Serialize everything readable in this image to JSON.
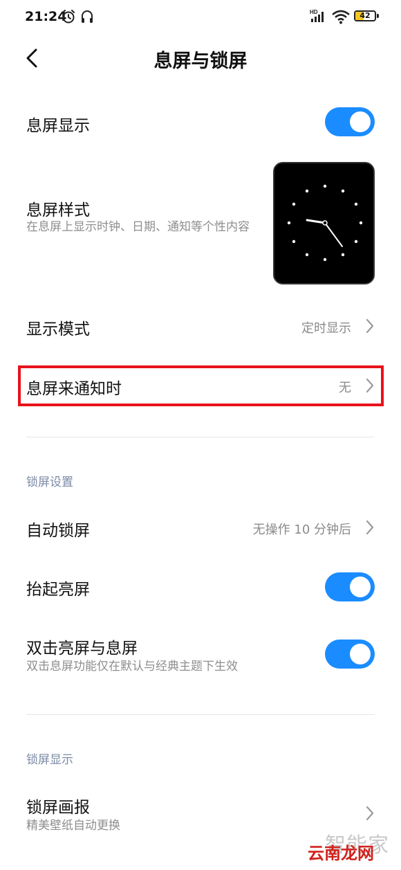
{
  "status_bar": {
    "time": "21:24",
    "signal_label": "HD",
    "battery_level": 42,
    "battery_text": "42",
    "icons": [
      "alarm-clock-icon",
      "headset-icon",
      "cellular-signal-icon",
      "wifi-icon",
      "battery-icon"
    ]
  },
  "header": {
    "title": "息屏与锁屏",
    "back_icon": "chevron-left-icon"
  },
  "aod": {
    "display": {
      "title": "息屏显示",
      "enabled": true
    },
    "style": {
      "title": "息屏样式",
      "subtitle": "在息屏上显示时钟、日期、通知等个性内容",
      "preview_icon": "analog-clock-icon"
    },
    "mode": {
      "title": "显示模式",
      "value": "定时显示"
    },
    "notification": {
      "title": "息屏来通知时",
      "value": "无"
    }
  },
  "lock_settings": {
    "section_title": "锁屏设置",
    "auto_lock": {
      "title": "自动锁屏",
      "value": "无操作 10 分钟后"
    },
    "raise_to_wake": {
      "title": "抬起亮屏",
      "enabled": true
    },
    "double_tap": {
      "title": "双击亮屏与息屏",
      "subtitle": "双击息屏功能仅在默认与经典主题下生效",
      "enabled": true
    }
  },
  "lock_display": {
    "section_title": "锁屏显示",
    "wallpaper_carousel": {
      "title": "锁屏画报",
      "subtitle": "精美壁纸自动更换"
    }
  },
  "watermark": {
    "line1": "智能家",
    "line2": "云南龙网"
  },
  "colors": {
    "accent": "#1a8cff",
    "highlight": "#e8121b",
    "section_label": "#7b8aa6",
    "secondary_text": "#8e8e8e",
    "battery_fill": "#f3c623"
  }
}
